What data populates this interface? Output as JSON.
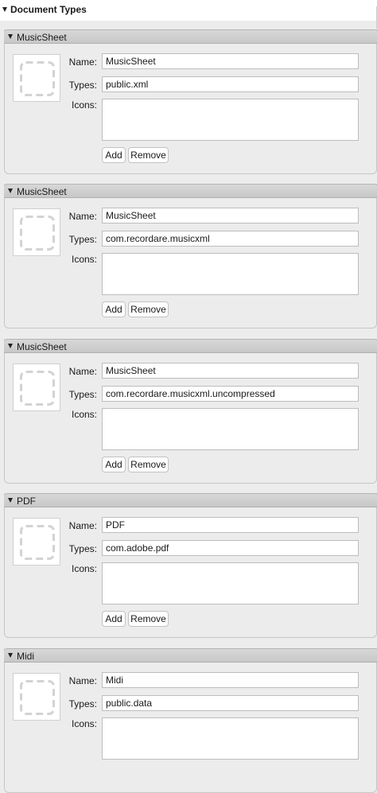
{
  "section": {
    "title": "Document Types"
  },
  "labels": {
    "name": "Name:",
    "types": "Types:",
    "icons": "Icons:",
    "add": "Add",
    "remove": "Remove"
  },
  "document_types": [
    {
      "title": "MusicSheet",
      "name": "MusicSheet",
      "types": "public.xml"
    },
    {
      "title": "MusicSheet",
      "name": "MusicSheet",
      "types": "com.recordare.musicxml"
    },
    {
      "title": "MusicSheet",
      "name": "MusicSheet",
      "types": "com.recordare.musicxml.uncompressed"
    },
    {
      "title": "PDF",
      "name": "PDF",
      "types": "com.adobe.pdf"
    },
    {
      "title": "Midi",
      "name": "Midi",
      "types": "public.data"
    }
  ]
}
